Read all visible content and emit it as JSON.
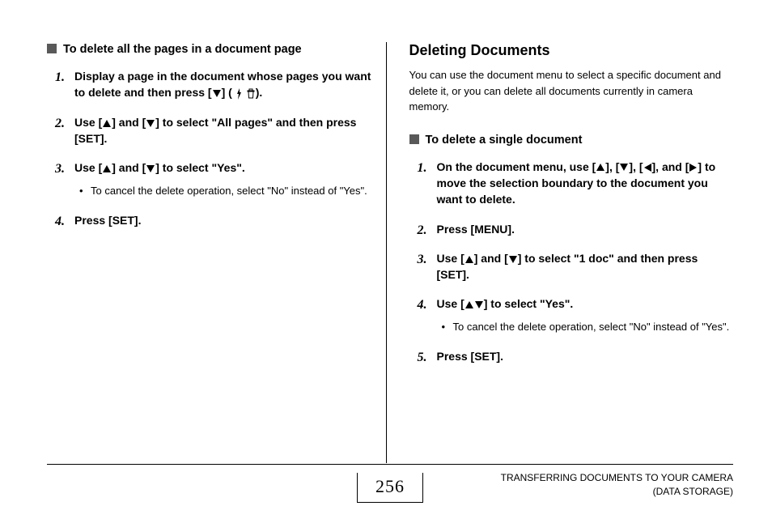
{
  "left": {
    "section_title": "To delete all the pages in a document page",
    "steps": [
      {
        "pre": "Display a page in the document whose pages you want to delete and then press [",
        "sym": "down",
        "post": "] (",
        "icon": "flash-trash",
        "tail": ")."
      },
      {
        "pre": "Use [",
        "sym": "up",
        "mid1": "] and [",
        "sym2": "down",
        "post": "] to select \"All pages\" and then press [SET]."
      },
      {
        "pre": "Use [",
        "sym": "up",
        "mid1": "] and [",
        "sym2": "down",
        "post": "] to select \"Yes\".",
        "sub": "To cancel the delete operation, select \"No\" instead of \"Yes\"."
      },
      {
        "plain": "Press [SET]."
      }
    ]
  },
  "right": {
    "heading": "Deleting Documents",
    "intro": "You can use the document menu to select a specific document and delete it, or you can delete all documents currently in camera memory.",
    "section_title": "To delete a single document",
    "steps": [
      {
        "pre": "On the document menu, use [",
        "sym": "up",
        "m1": "], [",
        "sym2": "down",
        "m2": "], [",
        "sym3": "left",
        "m3": "], and [",
        "sym4": "right",
        "post": "] to move the selection boundary to the document you want to delete."
      },
      {
        "plain": "Press [MENU]."
      },
      {
        "pre": "Use [",
        "sym": "up",
        "mid1": "] and [",
        "sym2": "down",
        "post": "] to select \"1 doc\" and then press [SET]."
      },
      {
        "pre": "Use [",
        "sym": "up",
        "mid1": "] and [",
        "sym2": "down",
        "post": "] to select \"Yes\".",
        "sub": "To cancel the delete operation, select \"No\" instead of \"Yes\"."
      },
      {
        "plain": "Press [SET]."
      }
    ]
  },
  "footer": {
    "page": "256",
    "line1": "TRANSFERRING DOCUMENTS TO YOUR CAMERA",
    "line2": "(DATA STORAGE)"
  }
}
